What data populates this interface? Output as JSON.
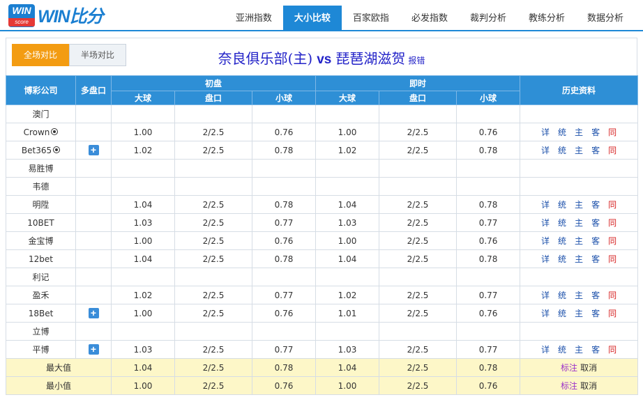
{
  "logo": {
    "box_top": "WIN",
    "box_bottom": "score",
    "text": "WIN比分"
  },
  "nav": {
    "tabs": [
      {
        "label": "亚洲指数",
        "active": false
      },
      {
        "label": "大小比较",
        "active": true
      },
      {
        "label": "百家欧指",
        "active": false
      },
      {
        "label": "必发指数",
        "active": false
      },
      {
        "label": "裁判分析",
        "active": false
      },
      {
        "label": "教练分析",
        "active": false
      },
      {
        "label": "数据分析",
        "active": false
      }
    ]
  },
  "toggle": {
    "full": "全场对比",
    "half": "半场对比"
  },
  "match": {
    "home": "奈良俱乐部(主)",
    "vs": "vs",
    "away": "琵琶湖滋贺",
    "report": "报错"
  },
  "headers": {
    "company": "博彩公司",
    "multi": "多盘口",
    "initial": "初盘",
    "live": "即时",
    "history": "历史资料",
    "big": "大球",
    "line": "盘口",
    "small": "小球"
  },
  "history_links": [
    "详",
    "统",
    "主",
    "客",
    "同"
  ],
  "rows": [
    {
      "company": "澳门",
      "ball": false,
      "plus": false,
      "odds": null
    },
    {
      "company": "Crown",
      "ball": true,
      "plus": false,
      "odds": [
        "1.00",
        "2/2.5",
        "0.76",
        "1.00",
        "2/2.5",
        "0.76"
      ]
    },
    {
      "company": "Bet365",
      "ball": true,
      "plus": true,
      "odds": [
        "1.02",
        "2/2.5",
        "0.78",
        "1.02",
        "2/2.5",
        "0.78"
      ]
    },
    {
      "company": "易胜博",
      "ball": false,
      "plus": false,
      "odds": null
    },
    {
      "company": "韦德",
      "ball": false,
      "plus": false,
      "odds": null
    },
    {
      "company": "明陞",
      "ball": false,
      "plus": false,
      "odds": [
        "1.04",
        "2/2.5",
        "0.78",
        "1.04",
        "2/2.5",
        "0.78"
      ]
    },
    {
      "company": "10BET",
      "ball": false,
      "plus": false,
      "odds": [
        "1.03",
        "2/2.5",
        "0.77",
        "1.03",
        "2/2.5",
        "0.77"
      ]
    },
    {
      "company": "金宝博",
      "ball": false,
      "plus": false,
      "odds": [
        "1.00",
        "2/2.5",
        "0.76",
        "1.00",
        "2/2.5",
        "0.76"
      ]
    },
    {
      "company": "12bet",
      "ball": false,
      "plus": false,
      "odds": [
        "1.04",
        "2/2.5",
        "0.78",
        "1.04",
        "2/2.5",
        "0.78"
      ]
    },
    {
      "company": "利记",
      "ball": false,
      "plus": false,
      "odds": null
    },
    {
      "company": "盈禾",
      "ball": false,
      "plus": false,
      "odds": [
        "1.02",
        "2/2.5",
        "0.77",
        "1.02",
        "2/2.5",
        "0.77"
      ]
    },
    {
      "company": "18Bet",
      "ball": false,
      "plus": true,
      "odds": [
        "1.00",
        "2/2.5",
        "0.76",
        "1.01",
        "2/2.5",
        "0.76"
      ]
    },
    {
      "company": "立博",
      "ball": false,
      "plus": false,
      "odds": null
    },
    {
      "company": "平博",
      "ball": false,
      "plus": true,
      "odds": [
        "1.03",
        "2/2.5",
        "0.77",
        "1.03",
        "2/2.5",
        "0.77"
      ]
    }
  ],
  "stats": [
    {
      "label": "最大值",
      "values": [
        "1.04",
        "2/2.5",
        "0.78",
        "1.04",
        "2/2.5",
        "0.78"
      ],
      "mark": "标注",
      "cancel": "取消"
    },
    {
      "label": "最小值",
      "values": [
        "1.00",
        "2/2.5",
        "0.76",
        "1.00",
        "2/2.5",
        "0.76"
      ],
      "mark": "标注",
      "cancel": "取消"
    }
  ],
  "colors": {
    "accent": "#1e88d6",
    "header": "#2e8fd6",
    "active_toggle": "#f39c12",
    "title": "#2323c8",
    "stat_row": "#fdf7c8"
  }
}
